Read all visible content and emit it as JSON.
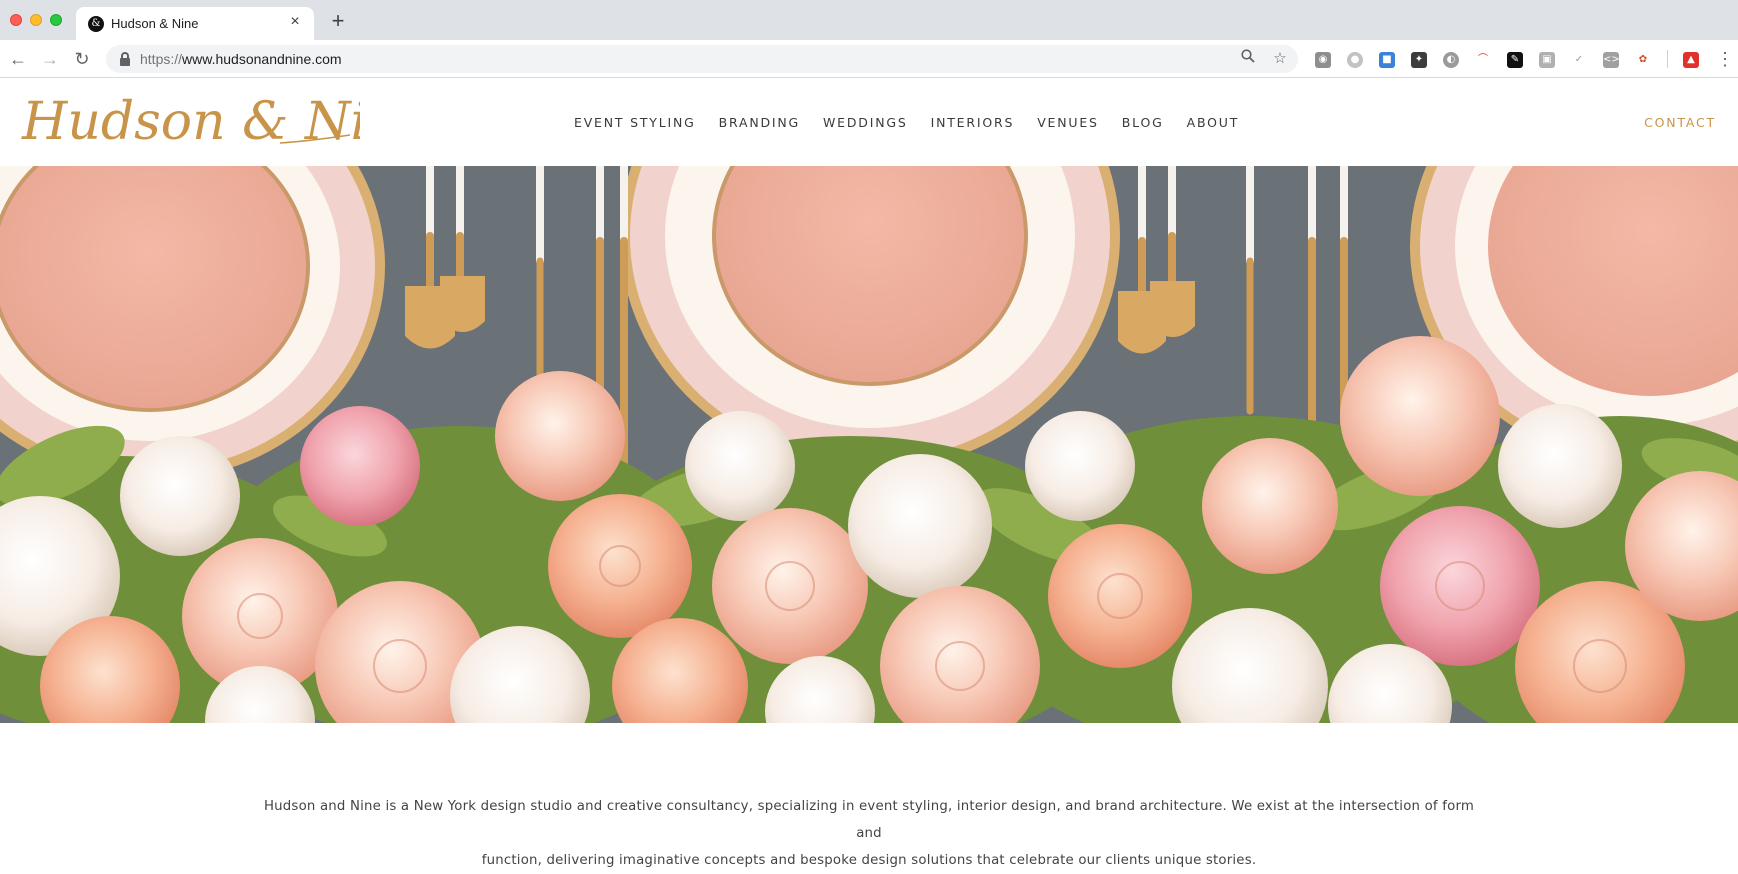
{
  "browser": {
    "tab_title": "Hudson & Nine",
    "url_scheme": "https://",
    "url_host": "www.hudsonandnine.com",
    "icons": [
      "back-icon",
      "forward-icon",
      "reload-icon",
      "lock-icon",
      "zoom-icon",
      "bookmark-star-icon",
      "menu-icon"
    ]
  },
  "site": {
    "logo_text": "Hudson & Nine",
    "nav": [
      "EVENT STYLING",
      "BRANDING",
      "WEDDINGS",
      "INTERIORS",
      "VENUES",
      "BLOG",
      "ABOUT"
    ],
    "contact": "CONTACT",
    "accent_color": "#c8944a",
    "intro_line1": "Hudson and Nine is a New York design studio and creative consultancy, specializing in event styling, interior design, and brand architecture. We exist at the intersection of form and",
    "intro_line2": "function, delivering imaginative concepts and bespoke design solutions that celebrate our clients unique stories."
  }
}
